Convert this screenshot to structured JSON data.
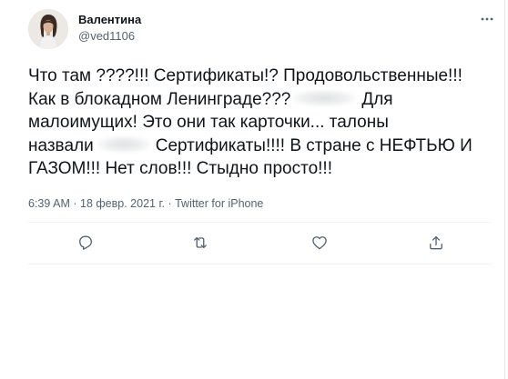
{
  "tweet": {
    "author": {
      "display_name": "Валентина",
      "handle": "@ved1106"
    },
    "text_lines": [
      "Что там ????!!!  Сертификаты!? Продовольственные!!!",
      "Как в блокадном Ленинграде???",
      "Для",
      "малоимущих! Это они так карточки... талоны",
      "назвали",
      "Сертификаты!!!! В стране с НЕФТЬЮ И",
      "ГАЗОМ!!! Нет слов!!! Стыдно просто!!!"
    ],
    "time": "6:39 AM",
    "date": "18 февр. 2021 г.",
    "source": "Twitter for iPhone",
    "separator": "·"
  },
  "icons": {
    "more": "more-dots-icon",
    "reply": "reply-icon",
    "retweet": "retweet-icon",
    "like": "like-icon",
    "share": "share-icon"
  },
  "colors": {
    "text": "#0f1419",
    "secondary": "#536471",
    "border": "#eff3f4"
  }
}
